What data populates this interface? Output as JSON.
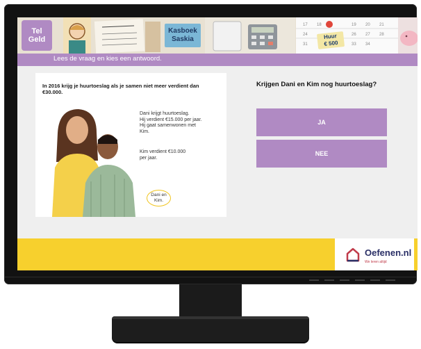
{
  "header": {
    "logo_line1": "Tel",
    "logo_line2": "Geld",
    "kasboek_line1": "Kasboek",
    "kasboek_line2": "Saskia",
    "huur_line1": "Huur",
    "huur_line2": "€ 500",
    "instruction": "Lees de vraag en kies een antwoord."
  },
  "card": {
    "heading": "In 2016 krijg je huurtoeslag als je samen niet meer verdient dan €30.000.",
    "text1": "Dani krijgt huurtoeslag.\nHij verdient €15.000 per jaar.\nHij gaat samenwonen met\nKim.",
    "text2": "Kim verdient €10.000\nper jaar.",
    "bubble": "Dani en Kim."
  },
  "quiz": {
    "question": "Krijgen Dani en Kim nog huurtoeslag?",
    "answers": [
      "JA",
      "NEE"
    ]
  },
  "footer": {
    "brand": "Oefenen.nl",
    "tagline": "We leren altijd"
  },
  "colors": {
    "accent": "#b08ac3",
    "footer_yellow": "#f7d02d",
    "brand_navy": "#2a2f66",
    "brand_red": "#c03b4a"
  }
}
